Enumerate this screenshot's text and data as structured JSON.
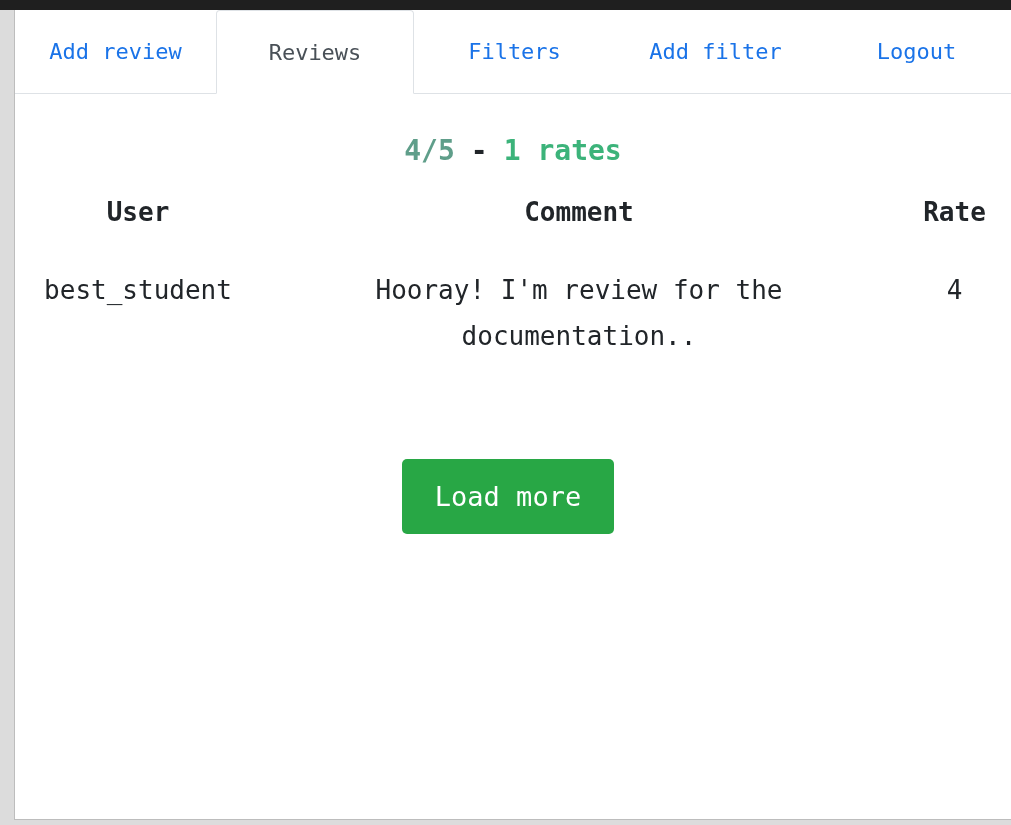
{
  "tabs": [
    {
      "label": "Add review",
      "selected": false
    },
    {
      "label": "Reviews",
      "selected": true
    },
    {
      "label": "Filters",
      "selected": false
    },
    {
      "label": "Add filter",
      "selected": false
    },
    {
      "label": "Logout",
      "selected": false
    }
  ],
  "summary": {
    "score": "4/5",
    "separator": "-",
    "count": "1 rates"
  },
  "table": {
    "columns": [
      "User",
      "Comment",
      "Rate"
    ],
    "rows": [
      {
        "user": "best_student",
        "comment": "Hooray! I'm review for the documentation..",
        "rate": "4"
      }
    ]
  },
  "load_more_button": "Load more"
}
